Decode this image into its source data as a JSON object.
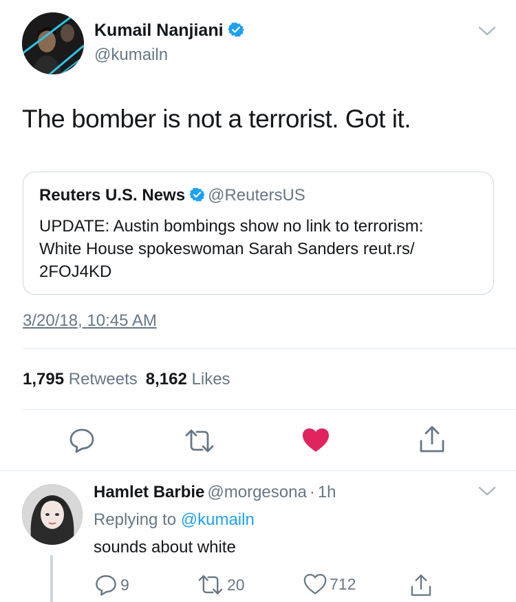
{
  "tweet": {
    "author_name": "Kumail Nanjiani",
    "author_handle": "@kumailn",
    "text": "The bomber is not a terrorist. Got it.",
    "timestamp": "3/20/18, 10:45 AM",
    "retweet_count": "1,795",
    "retweet_label": "Retweets",
    "like_count": "8,162",
    "like_label": "Likes",
    "liked": true
  },
  "quote": {
    "author_name": "Reuters U.S. News",
    "author_handle": "@ReutersUS",
    "line1": "UPDATE: Austin bombings show no link to terrorism:",
    "line2": "White House spokeswoman Sarah Sanders reut.rs/",
    "line3": "2FOJ4KD"
  },
  "reply": {
    "author_name": "Hamlet Barbie",
    "author_handle": "@morgesona",
    "separator": "·",
    "time": "1h",
    "replying_prefix": "Replying to",
    "replying_to": "@kumailn",
    "text": "sounds about white",
    "reply_count": "9",
    "retweet_count": "20",
    "like_count": "712"
  },
  "colors": {
    "accent": "#1da1f2",
    "like": "#e0245e",
    "secondary_text": "#657786",
    "border": "#e1e8ed"
  },
  "icons": [
    "verified-badge-icon",
    "chevron-down-icon",
    "reply-icon",
    "retweet-icon",
    "heart-icon",
    "share-icon"
  ]
}
